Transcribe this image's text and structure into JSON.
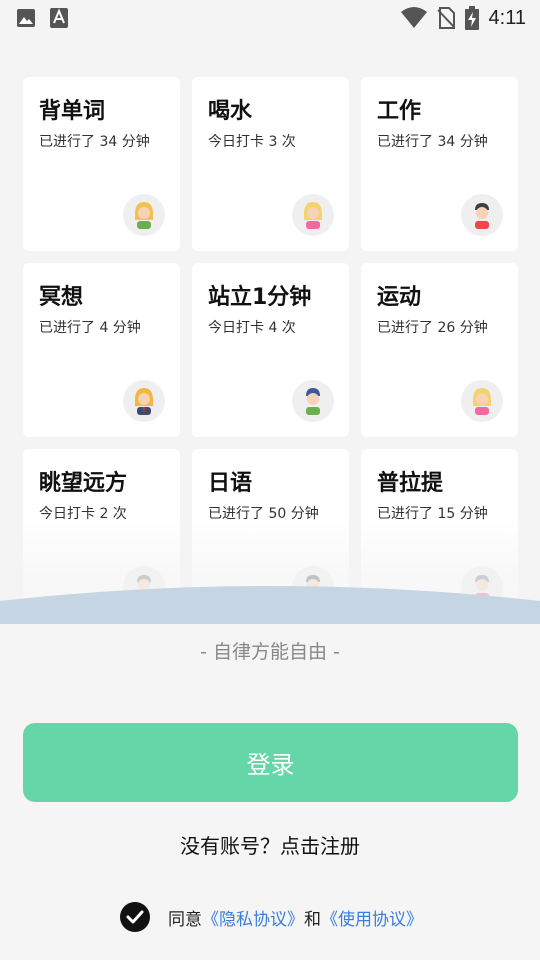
{
  "status_bar": {
    "time": "4:11",
    "left_icons": [
      "image-icon",
      "font-icon"
    ],
    "right_icons": [
      "wifi-icon",
      "no-sim-icon",
      "battery-charging-icon"
    ]
  },
  "cards": [
    {
      "title": "背单词",
      "subtitle": "已进行了 34 分钟",
      "avatar": "woman-blonde-green"
    },
    {
      "title": "喝水",
      "subtitle": "今日打卡 3 次",
      "avatar": "woman-blonde-pink"
    },
    {
      "title": "工作",
      "subtitle": "已进行了 34 分钟",
      "avatar": "man-dark-red"
    },
    {
      "title": "冥想",
      "subtitle": "已进行了 4 分钟",
      "avatar": "woman-suit"
    },
    {
      "title": "站立1分钟",
      "subtitle": "今日打卡 4 次",
      "avatar": "man-blue-hair-green"
    },
    {
      "title": "运动",
      "subtitle": "已进行了 26 分钟",
      "avatar": "woman-blonde-pink"
    },
    {
      "title": "眺望远方",
      "subtitle": "今日打卡 2 次",
      "avatar": "man-gray-red"
    },
    {
      "title": "日语",
      "subtitle": "已进行了 50 分钟",
      "avatar": "man-gray-green"
    },
    {
      "title": "普拉提",
      "subtitle": "已进行了 15 分钟",
      "avatar": "man-gray-red"
    }
  ],
  "slogan": "- 自律方能自由 -",
  "login_button": "登录",
  "register_link": "没有账号？点击注册",
  "agreement": {
    "prefix": "同意",
    "privacy": "《隐私协议》",
    "and": "和",
    "terms": "《使用协议》"
  },
  "colors": {
    "accent": "#64d6a8",
    "link": "#3b7de0"
  }
}
